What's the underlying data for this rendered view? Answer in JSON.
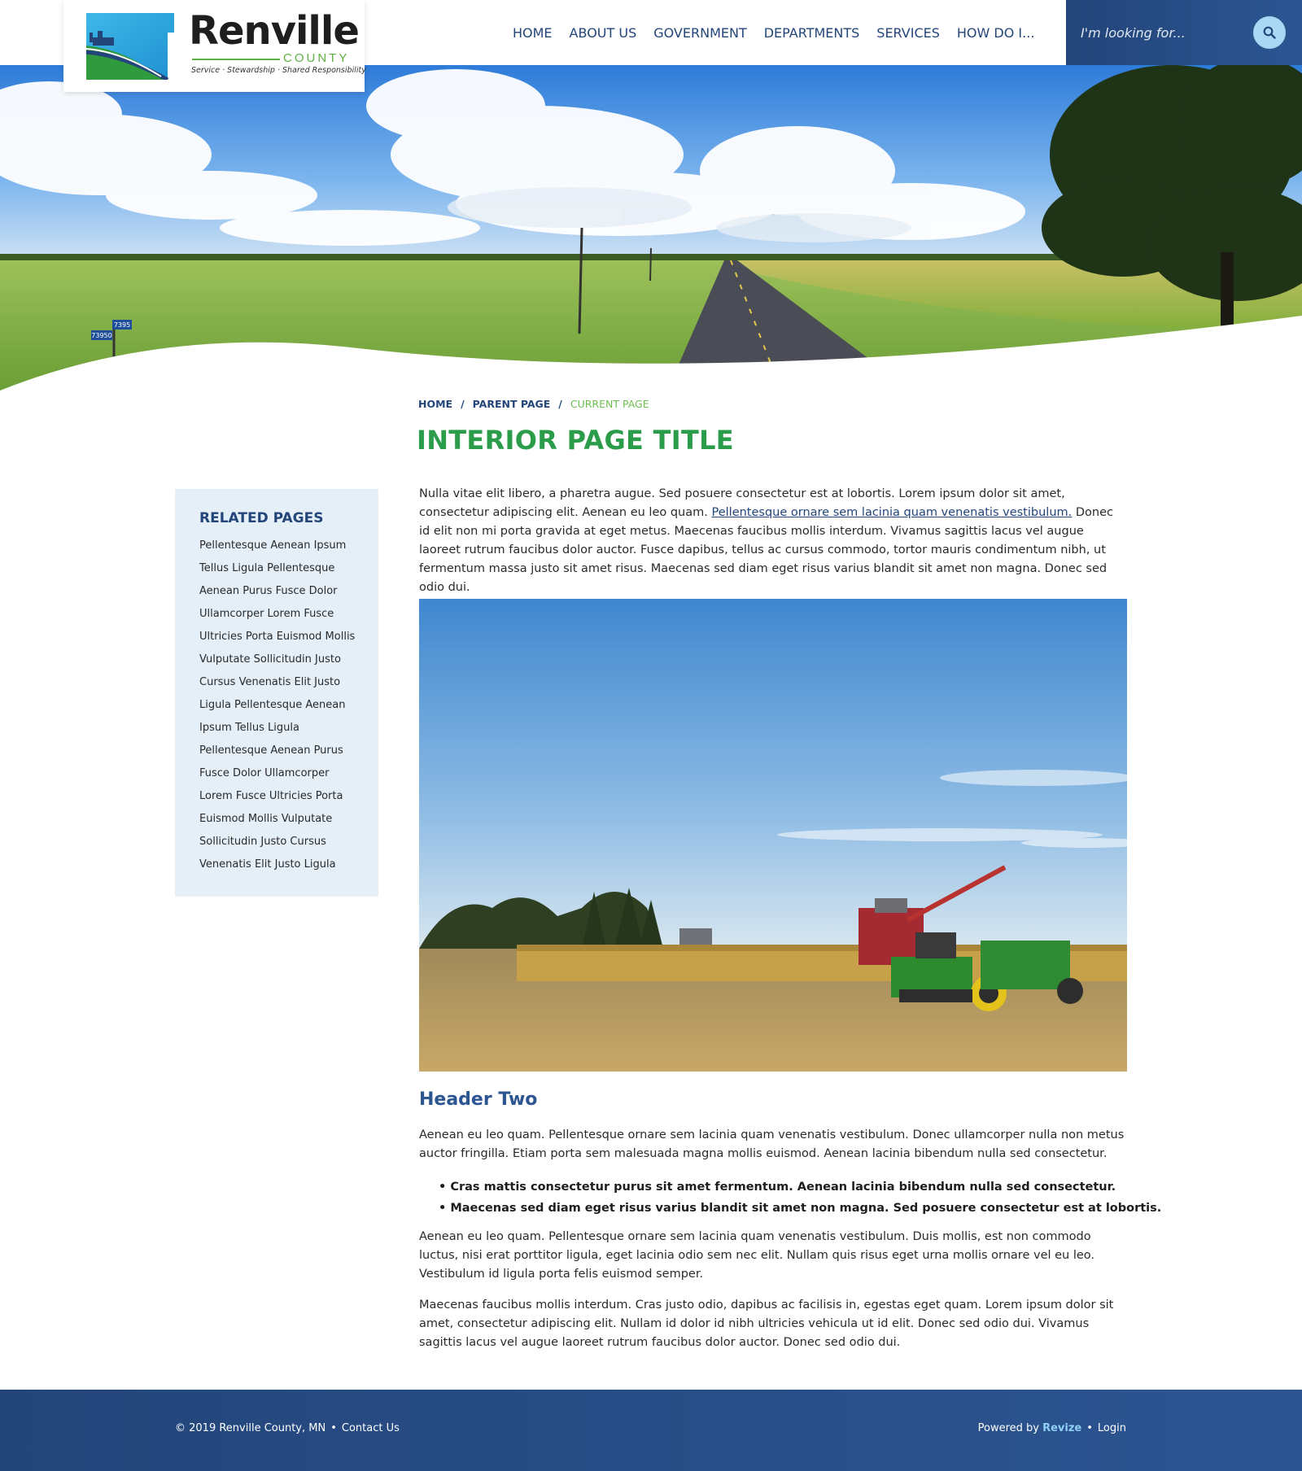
{
  "header": {
    "logo": {
      "name": "Renville",
      "subname": "COUNTY",
      "tagline": "Service · Stewardship · Shared Responsibility"
    },
    "nav": [
      {
        "label": "HOME"
      },
      {
        "label": "ABOUT US"
      },
      {
        "label": "GOVERNMENT"
      },
      {
        "label": "DEPARTMENTS"
      },
      {
        "label": "SERVICES"
      },
      {
        "label": "HOW DO I..."
      }
    ],
    "search": {
      "placeholder": "I'm looking for...",
      "icon": "search-icon"
    }
  },
  "hero": {
    "road_signs": [
      "7395",
      "73950"
    ]
  },
  "breadcrumb": {
    "home": "HOME",
    "parent": "PARENT PAGE",
    "current": "CURRENT PAGE",
    "separator": "/"
  },
  "page_title": "INTERIOR PAGE TITLE",
  "sidebar": {
    "title": "RELATED PAGES",
    "items": [
      "Pellentesque Aenean Ipsum",
      "Tellus Ligula Pellentesque",
      "Aenean Purus Fusce Dolor",
      "Ullamcorper Lorem Fusce",
      "Ultricies Porta Euismod Mollis",
      "Vulputate Sollicitudin Justo",
      "Cursus Venenatis Elit Justo",
      "Ligula Pellentesque Aenean",
      "Ipsum Tellus Ligula",
      "Pellentesque Aenean Purus",
      "Fusce Dolor Ullamcorper",
      "Lorem Fusce Ultricies Porta",
      "Euismod Mollis Vulputate",
      "Sollicitudin Justo Cursus",
      "Venenatis Elit Justo Ligula"
    ]
  },
  "content": {
    "intro_before": "Nulla vitae elit libero, a pharetra augue. Sed posuere consectetur est at lobortis. Lorem ipsum dolor sit amet, consectetur adipiscing elit. Aenean eu leo quam. ",
    "intro_link": "Pellentesque ornare sem lacinia quam venenatis vestibulum.",
    "intro_after": " Donec id elit non mi porta gravida at eget metus. Maecenas faucibus mollis interdum. Vivamus sagittis lacus vel augue laoreet rutrum faucibus dolor auctor. Fusce dapibus, tellus ac cursus commodo, tortor mauris condimentum nibh, ut fermentum massa justo sit amet risus. Maecenas sed diam eget risus varius blandit sit amet non magna. Donec sed odio dui.",
    "header_two": "Header Two",
    "paragraph2": "Aenean eu leo quam. Pellentesque ornare sem lacinia quam venenatis vestibulum. Donec ullamcorper nulla non metus auctor fringilla. Etiam porta sem malesuada magna mollis euismod. Aenean lacinia bibendum nulla sed consectetur.",
    "bullets": [
      "Cras mattis consectetur purus sit amet fermentum. Aenean lacinia bibendum nulla sed consectetur.",
      "Maecenas sed diam eget risus varius blandit sit amet non magna. Sed posuere consectetur est at lobortis."
    ],
    "paragraph3": "Aenean eu leo quam. Pellentesque ornare sem lacinia quam venenatis vestibulum. Duis mollis, est non commodo luctus, nisi erat porttitor ligula, eget lacinia odio sem nec elit. Nullam quis risus eget urna mollis ornare vel eu leo. Vestibulum id ligula porta felis euismod semper.",
    "paragraph4": "Maecenas faucibus mollis interdum. Cras justo odio, dapibus ac facilisis in, egestas eget quam. Lorem ipsum dolor sit amet, consectetur adipiscing elit. Nullam id dolor id nibh ultricies vehicula ut id elit. Donec sed odio dui. Vivamus sagittis lacus vel augue laoreet rutrum faucibus dolor auctor. Donec sed odio dui."
  },
  "footer": {
    "copyright": "© 2019 Renville County, MN",
    "contact": "Contact Us",
    "powered_by": "Powered by",
    "brand": "Revize",
    "login": "Login",
    "separator": "•"
  },
  "colors": {
    "primary_blue": "#23457a",
    "title_green": "#2a9c4a",
    "breadcrumb_current_green": "#6cbf4f",
    "sidebar_bg": "#e4eff7",
    "search_button": "#a9d8f5",
    "revize_link": "#8fd0f5"
  }
}
